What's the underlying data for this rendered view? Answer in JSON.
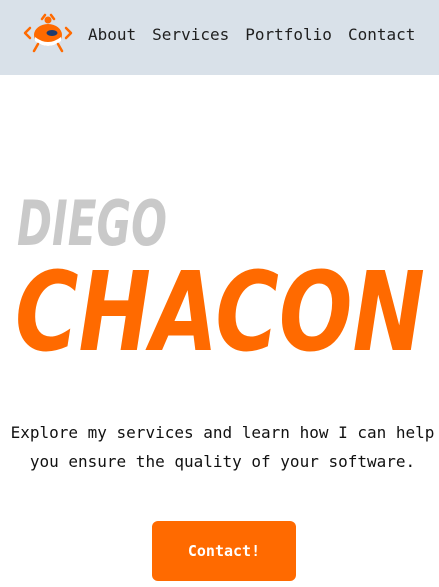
{
  "nav": {
    "links": [
      "About",
      "Services",
      "Portfolio",
      "Contact"
    ]
  },
  "hero": {
    "first_name": "DIEGO",
    "last_name": "CHACON",
    "description": "Explore my services and learn how I can help you ensure the quality of your software.",
    "cta_label": "Contact!"
  },
  "colors": {
    "accent": "#ff6a00",
    "nav_background": "#d9e1e9",
    "first_name_gray": "#c9c9c9"
  },
  "icons": {
    "logo": "bug-icon"
  }
}
